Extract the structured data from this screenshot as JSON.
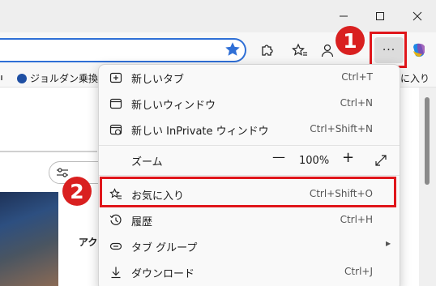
{
  "favorites_bar": {
    "items": [
      "ジョルダン",
      "乗換"
    ],
    "right_label": "に入り"
  },
  "content": {
    "side_text": "アク"
  },
  "more_button": {
    "label": "···"
  },
  "menu": {
    "items": [
      {
        "label": "新しいタブ",
        "shortcut": "Ctrl+T",
        "icon": "new-tab-icon"
      },
      {
        "label": "新しいウィンドウ",
        "shortcut": "Ctrl+N",
        "icon": "new-window-icon"
      },
      {
        "label": "新しい InPrivate ウィンドウ",
        "shortcut": "Ctrl+Shift+N",
        "icon": "inprivate-icon"
      },
      {
        "label": "ズーム",
        "icon": ""
      },
      {
        "label": "お気に入り",
        "shortcut": "Ctrl+Shift+O",
        "icon": "favorites-star-icon"
      },
      {
        "label": "履歴",
        "shortcut": "Ctrl+H",
        "icon": "history-icon"
      },
      {
        "label": "タブ グループ",
        "icon": "tab-groups-icon"
      },
      {
        "label": "ダウンロード",
        "shortcut": "Ctrl+J",
        "icon": "download-icon"
      }
    ],
    "zoom": {
      "minus": "—",
      "value": "100%",
      "plus": "+"
    }
  },
  "annotations": {
    "badge_1": "1",
    "badge_2": "2",
    "highlight_color": "#e0161b"
  },
  "colors": {
    "accent": "#2f6fd6",
    "highlight": "#e0161b"
  }
}
